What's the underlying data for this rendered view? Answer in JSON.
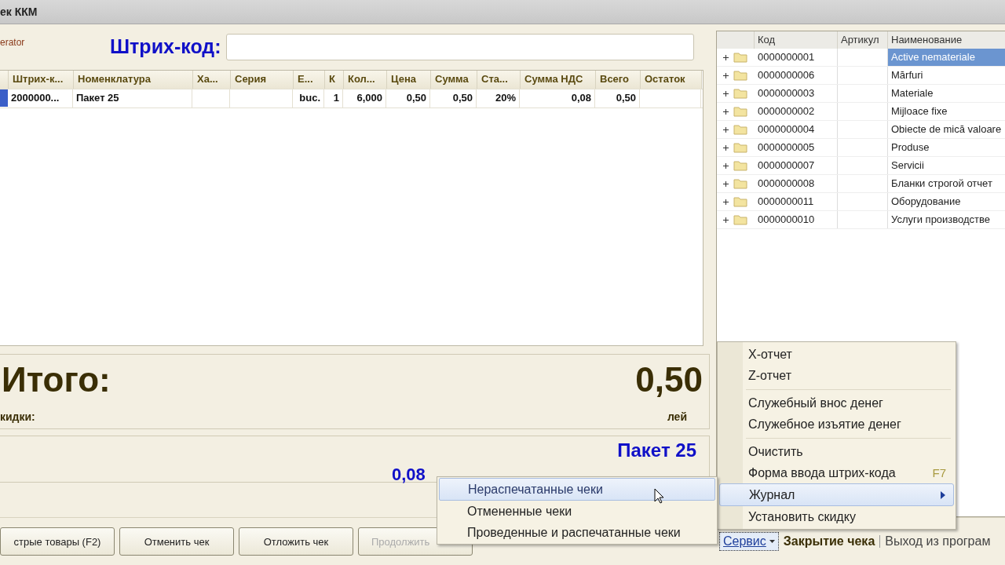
{
  "window": {
    "title": "ек ККМ"
  },
  "operator_label": "erator",
  "barcode": {
    "label": "Штрих-код:"
  },
  "items_table": {
    "columns": [
      {
        "kind": "marker"
      },
      {
        "label": "Штрих-к...",
        "kind": "text"
      },
      {
        "label": "Номенклатура",
        "kind": "text"
      },
      {
        "label": "Ха...",
        "kind": "text"
      },
      {
        "label": "Серия",
        "kind": "text"
      },
      {
        "label": "Е...",
        "kind": "number"
      },
      {
        "label": "К",
        "kind": "number"
      },
      {
        "label": "Кол...",
        "kind": "number"
      },
      {
        "label": "Цена",
        "kind": "number"
      },
      {
        "label": "Сумма",
        "kind": "number"
      },
      {
        "label": "Ста...",
        "kind": "number"
      },
      {
        "label": "Сумма НДС",
        "kind": "number"
      },
      {
        "label": "Всего",
        "kind": "number"
      },
      {
        "label": "Остаток",
        "kind": "number"
      }
    ],
    "rows": [
      {
        "selected": true,
        "cells": [
          null,
          "2000000...",
          "Пакет 25",
          null,
          null,
          "buc.",
          "1",
          "6,000",
          "0,50",
          "0,50",
          "20%",
          "0,08",
          "0,50",
          null
        ]
      }
    ]
  },
  "totals": {
    "label": "Итого:",
    "amount": "0,50",
    "discount_label": "кидки:",
    "currency": "лей"
  },
  "product_info": {
    "name": "Пакет 25",
    "line": "0,08"
  },
  "tree": {
    "columns": [
      "Код",
      "Артикул",
      "Наименование"
    ],
    "rows": [
      {
        "code": "0000000001",
        "name": "Active nemateriale",
        "selected": true,
        "expanded": false
      },
      {
        "code": "0000000006",
        "name": "Mărfuri",
        "selected": false,
        "expanded": false
      },
      {
        "code": "0000000003",
        "name": "Materiale",
        "selected": false,
        "expanded": false
      },
      {
        "code": "0000000002",
        "name": "Mijloace fixe",
        "selected": false,
        "expanded": false
      },
      {
        "code": "0000000004",
        "name": "Obiecte de mică valoare",
        "selected": false,
        "expanded": false
      },
      {
        "code": "0000000005",
        "name": "Produse",
        "selected": false,
        "expanded": false
      },
      {
        "code": "0000000007",
        "name": "Servicii",
        "selected": false,
        "expanded": false
      },
      {
        "code": "0000000008",
        "name": "Бланки строгой отчет",
        "selected": false,
        "expanded": false
      },
      {
        "code": "0000000011",
        "name": "Оборудование",
        "selected": false,
        "expanded": false
      },
      {
        "code": "0000000010",
        "name": "Услуги производстве",
        "selected": false,
        "expanded": false
      }
    ]
  },
  "buttons": [
    {
      "label": "стрые товары (F2)",
      "disabled": false
    },
    {
      "label": "Отменить чек",
      "disabled": false
    },
    {
      "label": "Отложить чек",
      "disabled": false
    },
    {
      "label": "Продолжить",
      "disabled": true
    }
  ],
  "service": {
    "label": "Сервис"
  },
  "links": [
    {
      "label": "Закрытие чека",
      "kind": "primary"
    },
    {
      "label": "Выход из програм",
      "kind": "plain"
    }
  ],
  "menu": {
    "items": [
      {
        "kind": "item",
        "label": "X-отчет",
        "selected": false,
        "submenu": false
      },
      {
        "kind": "item",
        "label": "Z-отчет",
        "selected": false,
        "submenu": false
      },
      {
        "kind": "separator"
      },
      {
        "kind": "item",
        "label": "Служебный внос денег",
        "selected": false,
        "submenu": false
      },
      {
        "kind": "item",
        "label": "Служебное изъятие денег",
        "selected": false,
        "submenu": false
      },
      {
        "kind": "separator"
      },
      {
        "kind": "item",
        "label": "Очистить",
        "selected": false,
        "submenu": false
      },
      {
        "kind": "item",
        "label": "Форма ввода штрих-кода",
        "shortcut": "F7",
        "selected": false,
        "submenu": false
      },
      {
        "kind": "item",
        "label": "Журнал",
        "selected": true,
        "submenu": true
      },
      {
        "kind": "item",
        "label": "Установить скидку",
        "selected": false,
        "submenu": false
      }
    ]
  },
  "submenu": {
    "items": [
      {
        "label": "Нераспечатанные чеки",
        "selected": true
      },
      {
        "label": "Отмененные чеки",
        "selected": false
      },
      {
        "label": "Проведенные и распечатанные чеки",
        "selected": false
      }
    ]
  }
}
